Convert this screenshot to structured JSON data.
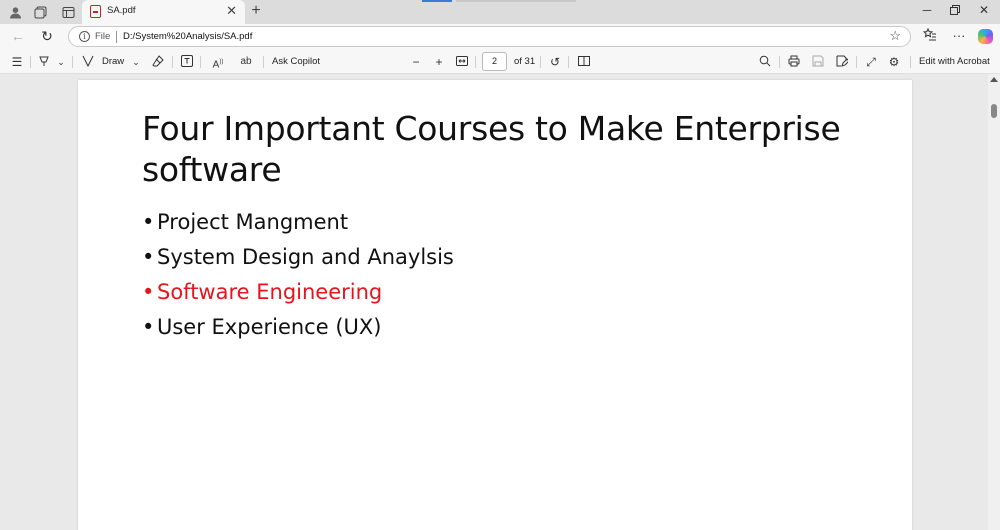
{
  "browser": {
    "tab_title": "SA.pdf",
    "tab_close": "✕",
    "new_tab": "+",
    "url_scheme": "File",
    "url": "D:/System%20Analysis/SA.pdf"
  },
  "pdf_toolbar": {
    "draw_label": "Draw",
    "ask_copilot_label": "Ask Copilot",
    "page_current": "2",
    "page_total": "of 31",
    "edit_with_acrobat_label": "Edit with Acrobat"
  },
  "document": {
    "title": "Four Important Courses to Make Enterprise software",
    "bullets": [
      {
        "text": "Project Mangment",
        "highlight_color": ""
      },
      {
        "text": "System Design and Anaylsis",
        "highlight_color": ""
      },
      {
        "text": "Software Engineering",
        "highlight_color": "#e8141b"
      },
      {
        "text": "User Experience (UX)",
        "highlight_color": ""
      }
    ]
  },
  "icons": {
    "tabstrip": [
      "profile-icon",
      "collections-icon",
      "tab-actions-icon"
    ],
    "nav": [
      "back-icon",
      "refresh-icon",
      "info-icon",
      "favorite-star-icon",
      "favorites-icon",
      "more-icon",
      "copilot-icon"
    ],
    "window": [
      "minimize-icon",
      "restore-icon",
      "close-icon"
    ],
    "pdf": [
      "contents-icon",
      "highlight-icon",
      "draw-icon",
      "erase-icon",
      "text-box-icon",
      "read-aloud-icon",
      "translate-icon",
      "zoom-out-icon",
      "zoom-in-icon",
      "fit-page-icon",
      "rotate-icon",
      "page-view-icon",
      "search-icon",
      "print-icon",
      "save-icon",
      "save-as-icon",
      "fullscreen-icon",
      "settings-icon"
    ]
  }
}
